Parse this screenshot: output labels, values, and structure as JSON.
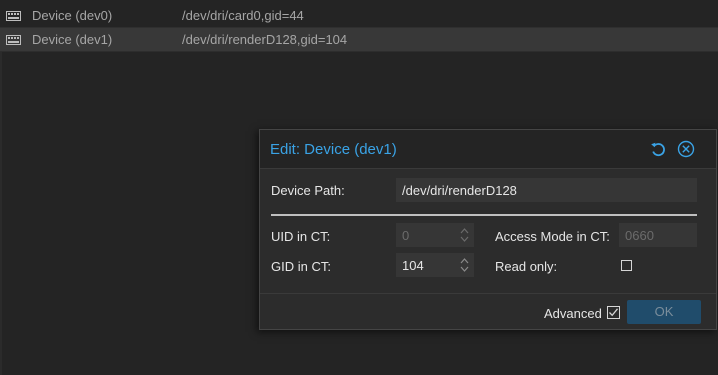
{
  "devices": [
    {
      "name": "Device (dev0)",
      "value": "/dev/dri/card0,gid=44"
    },
    {
      "name": "Device (dev1)",
      "value": "/dev/dri/renderD128,gid=104"
    }
  ],
  "dialog": {
    "title": "Edit: Device (dev1)",
    "device_path_label": "Device Path:",
    "device_path_value": "/dev/dri/renderD128",
    "uid_label": "UID in CT:",
    "uid_value": "0",
    "gid_label": "GID in CT:",
    "gid_value": "104",
    "access_mode_label": "Access Mode in CT:",
    "access_mode_value": "0660",
    "read_only_label": "Read only:",
    "read_only_checked": false,
    "advanced_label": "Advanced",
    "advanced_checked": true,
    "ok_label": "OK"
  },
  "colors": {
    "accent": "#3aa3e6",
    "background": "#242424",
    "ok_button": "#204c6b"
  }
}
